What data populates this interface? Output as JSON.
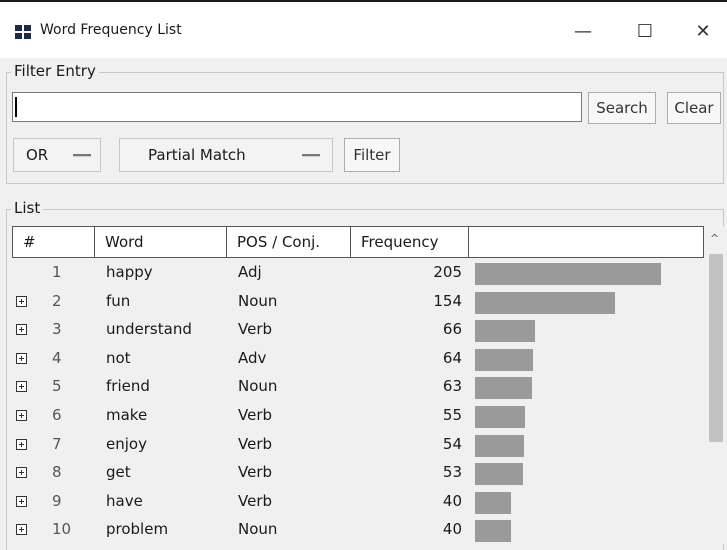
{
  "window": {
    "title": "Word Frequency List",
    "controls": {
      "minimize": "—",
      "maximize": "☐",
      "close": "✕"
    }
  },
  "filter": {
    "legend": "Filter Entry",
    "input_value": "",
    "search_label": "Search",
    "clear_label": "Clear",
    "logic_select": "OR",
    "match_select": "Partial Match",
    "filter_label": "Filter"
  },
  "list": {
    "legend": "List",
    "columns": [
      "#",
      "Word",
      "POS / Conj.",
      "Frequency",
      ""
    ],
    "rows": [
      {
        "num": "1",
        "word": "happy",
        "pos": "Adj",
        "freq": "205",
        "expandable": false
      },
      {
        "num": "2",
        "word": "fun",
        "pos": "Noun",
        "freq": "154",
        "expandable": true
      },
      {
        "num": "3",
        "word": "understand",
        "pos": "Verb",
        "freq": "66",
        "expandable": true
      },
      {
        "num": "4",
        "word": "not",
        "pos": "Adv",
        "freq": "64",
        "expandable": true
      },
      {
        "num": "5",
        "word": "friend",
        "pos": "Noun",
        "freq": "63",
        "expandable": true
      },
      {
        "num": "6",
        "word": "make",
        "pos": "Verb",
        "freq": "55",
        "expandable": true
      },
      {
        "num": "7",
        "word": "enjoy",
        "pos": "Verb",
        "freq": "54",
        "expandable": true
      },
      {
        "num": "8",
        "word": "get",
        "pos": "Verb",
        "freq": "53",
        "expandable": true
      },
      {
        "num": "9",
        "word": "have",
        "pos": "Verb",
        "freq": "40",
        "expandable": true
      },
      {
        "num": "10",
        "word": "problem",
        "pos": "Noun",
        "freq": "40",
        "expandable": true
      }
    ],
    "max_frequency": 205
  },
  "colors": {
    "bar": "#9a9a9a",
    "app_icon": "#1e2a4a"
  },
  "icons": {
    "app": "app-icon",
    "expand": "plus-box-icon",
    "scroll_up": "scroll-up-arrow-icon"
  }
}
